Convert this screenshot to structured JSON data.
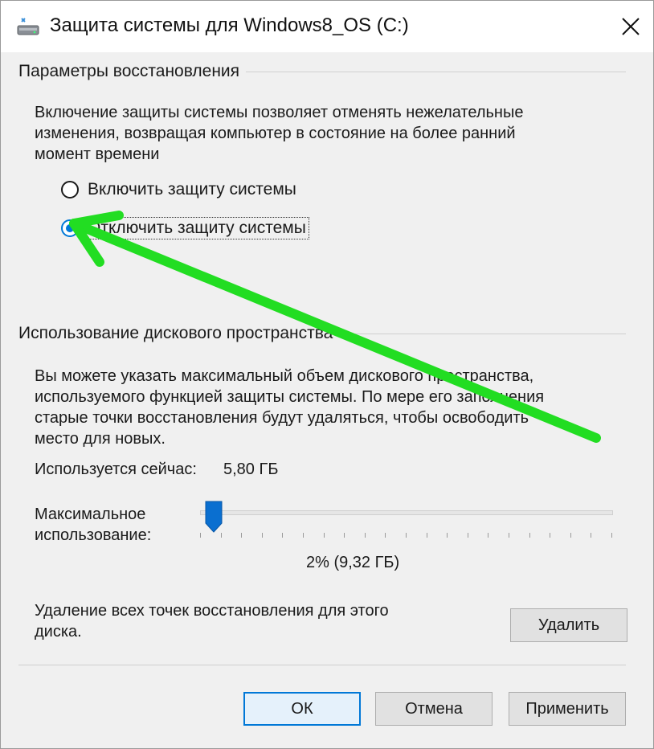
{
  "window": {
    "title": "Защита системы для Windows8_OS (C:)",
    "accent_color": "#0078d7"
  },
  "restore_settings": {
    "legend": "Параметры восстановления",
    "description": "Включение защиты системы позволяет отменять нежелательные\nизменения, возвращая компьютер в состояние на более ранний\nмомент времени",
    "options": [
      {
        "label": "Включить защиту системы",
        "checked": false
      },
      {
        "label": "Отключить защиту системы",
        "checked": true
      }
    ]
  },
  "disk_usage": {
    "legend": "Использование дискового пространства",
    "description": "Вы можете указать максимальный объем дискового пространства,\nиспользуемого функцией защиты системы. По мере его заполнения\nстарые точки восстановления будут удаляться, чтобы освободить\nместо для новых.",
    "current_usage_label": "Используется сейчас:",
    "current_usage_value": "5,80 ГБ",
    "max_usage_label": "Максимальное\nиспользование:",
    "slider_value_fraction": 0.02,
    "percent_text": "2% (9,32 ГБ)",
    "delete_text": "Удаление всех точек восстановления для этого\nдиска.",
    "delete_button": "Удалить"
  },
  "footer": {
    "ok_button": "ОК",
    "cancel_button": "Отмена",
    "apply_button": "Применить"
  },
  "annotation": {
    "arrow_color": "#22dd22"
  }
}
